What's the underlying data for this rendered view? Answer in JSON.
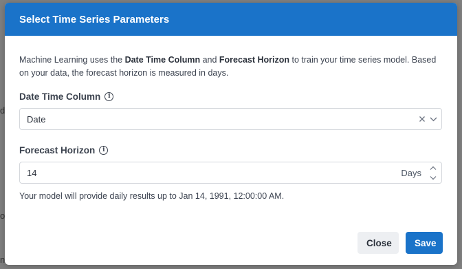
{
  "background": {
    "snippets": [
      "di",
      "o",
      "n"
    ]
  },
  "dialog": {
    "title": "Select Time Series Parameters",
    "intro": {
      "part1": "Machine Learning uses the ",
      "bold1": "Date Time Column",
      "part2": " and ",
      "bold2": "Forecast Horizon",
      "part3": " to train your time series model. Based on your data, the forecast horizon is measured in days."
    },
    "date_time_column": {
      "label": "Date Time Column",
      "value": "Date"
    },
    "forecast_horizon": {
      "label": "Forecast Horizon",
      "value": "14",
      "unit": "Days"
    },
    "helper_text": "Your model will provide daily results up to Jan 14, 1991, 12:00:00 AM.",
    "buttons": {
      "close": "Close",
      "save": "Save"
    }
  },
  "colors": {
    "accent": "#1a73c9",
    "secondary_button": "#edeff2"
  },
  "icons": {
    "info": "info-icon",
    "clear": "close-icon",
    "dropdown": "chevron-down-icon",
    "step_up": "chevron-up-icon",
    "step_down": "chevron-down-icon"
  }
}
